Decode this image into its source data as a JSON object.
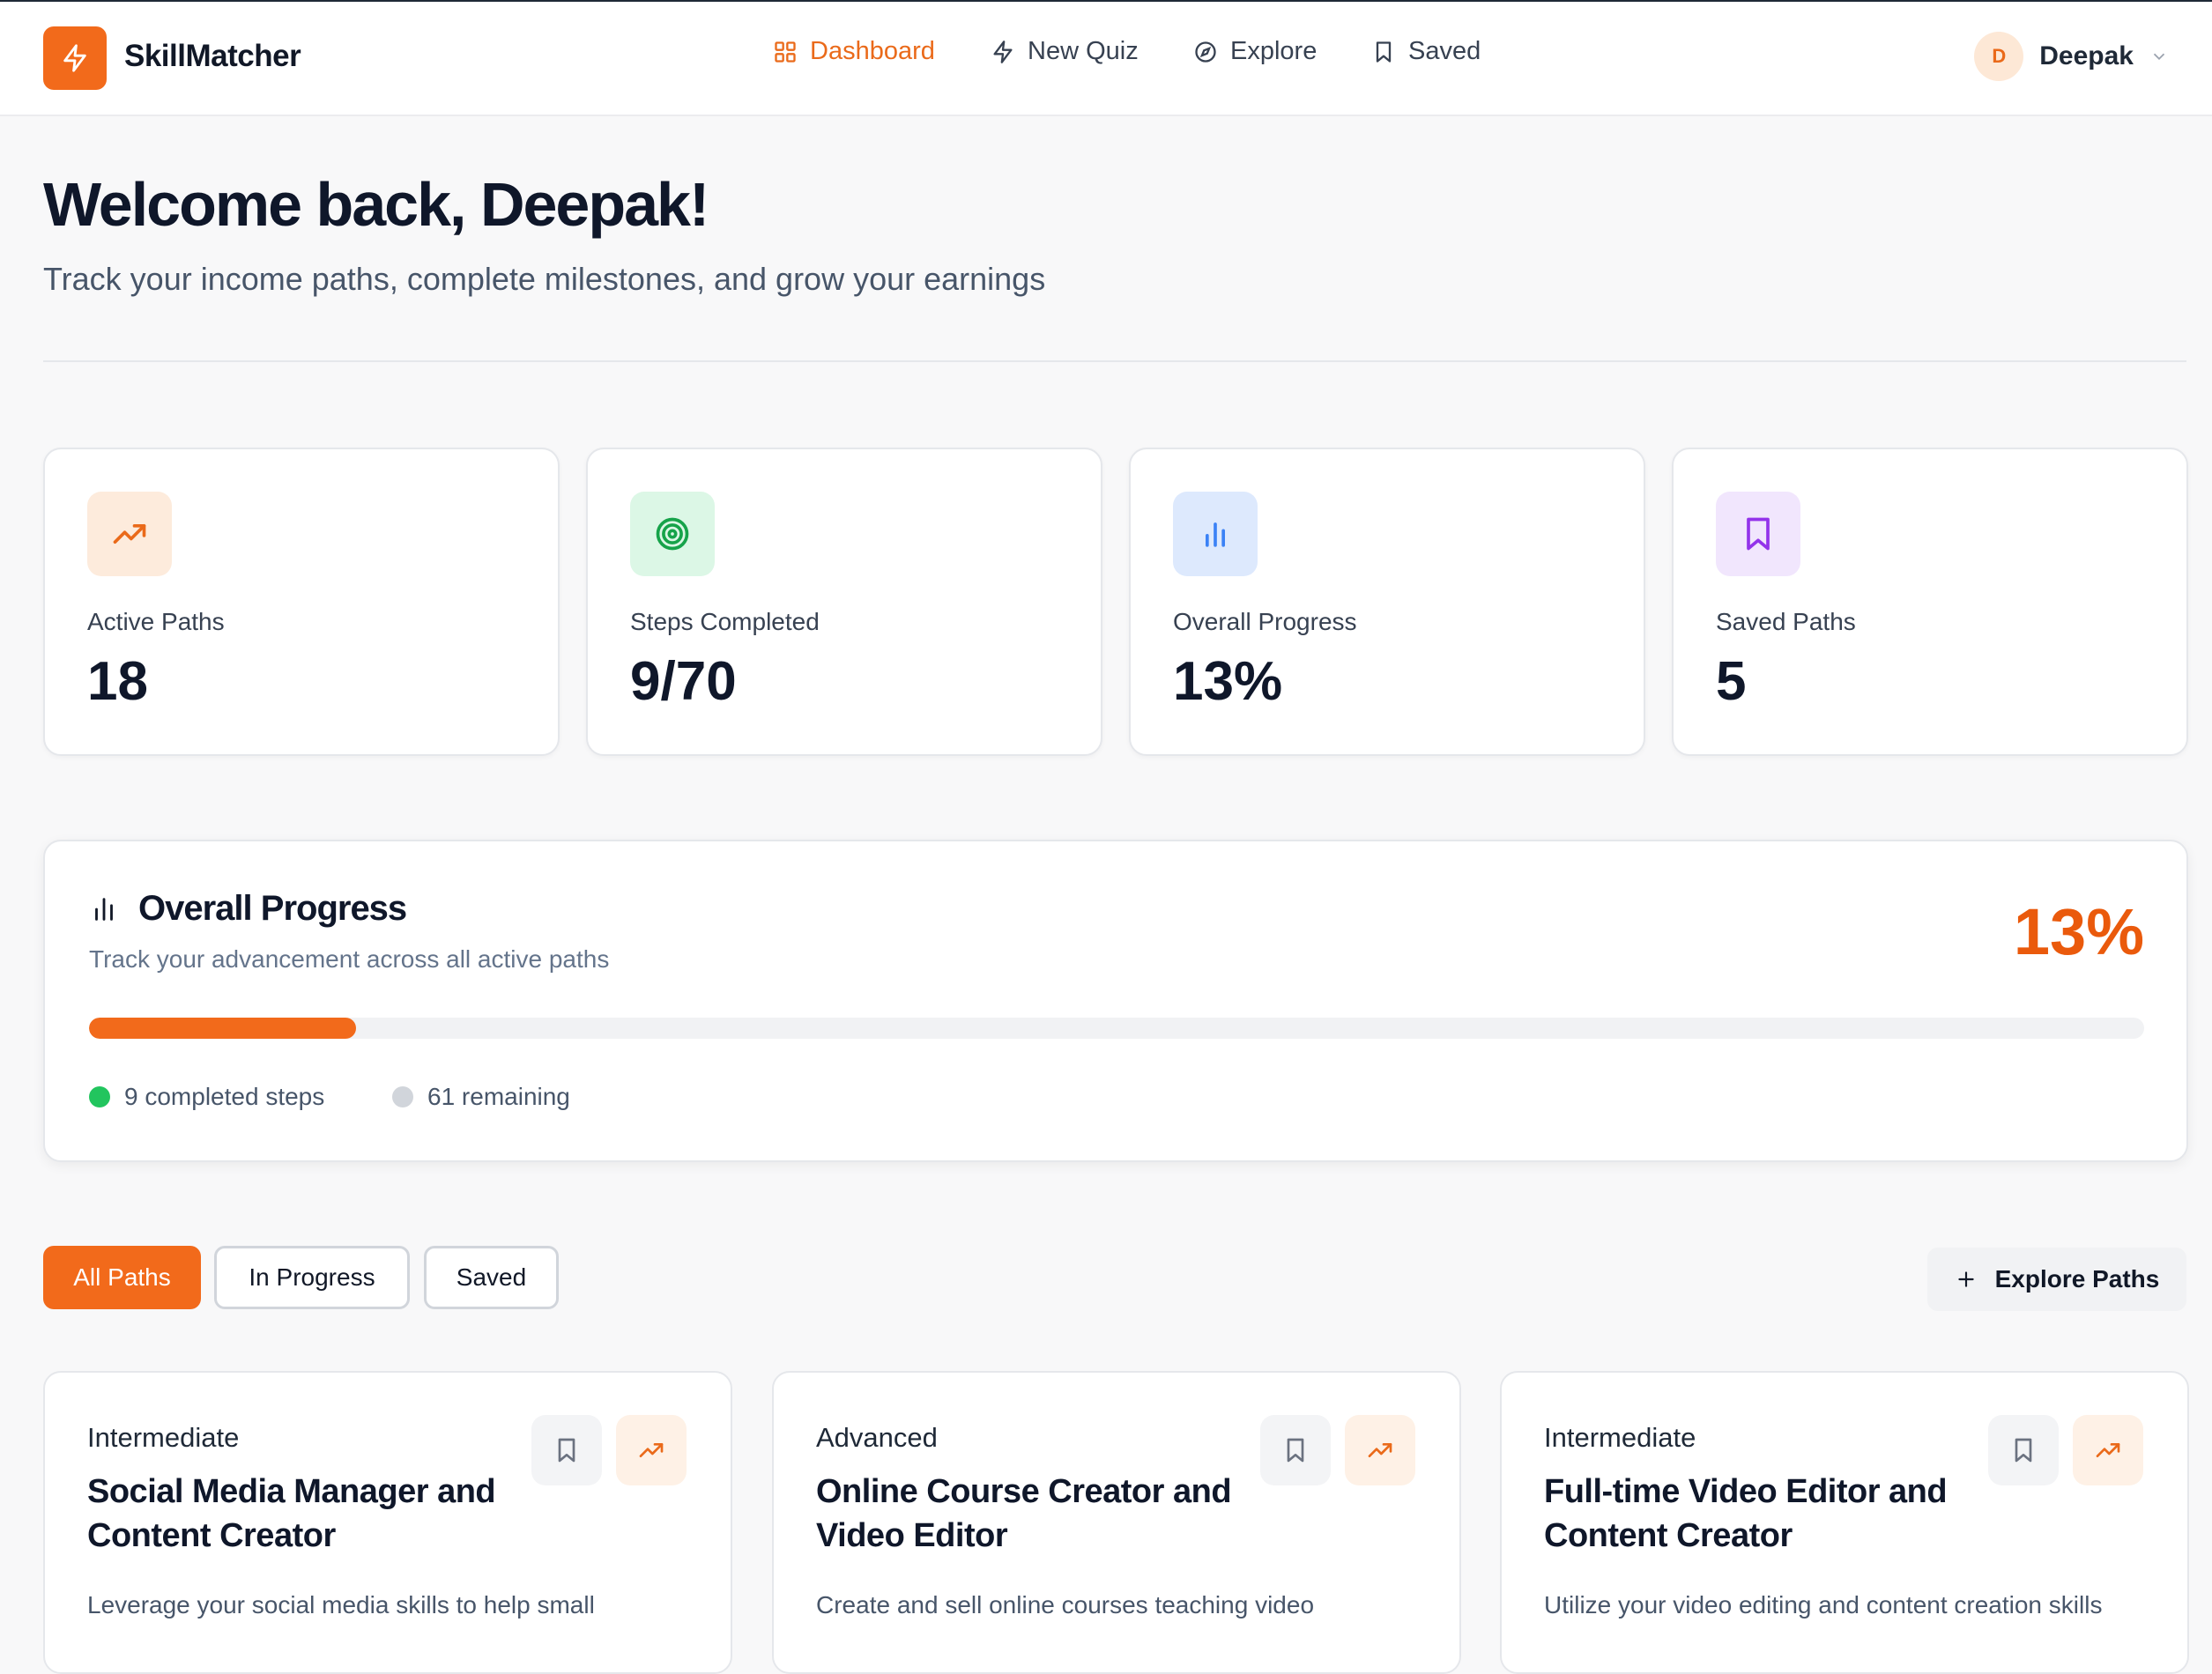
{
  "app": {
    "name": "SkillMatcher"
  },
  "nav": {
    "dashboard": "Dashboard",
    "new_quiz": "New Quiz",
    "explore": "Explore",
    "saved": "Saved"
  },
  "user": {
    "initial": "D",
    "name": "Deepak"
  },
  "welcome": {
    "title": "Welcome back, Deepak!",
    "subtitle": "Track your income paths, complete milestones, and grow your earnings"
  },
  "stats": [
    {
      "label": "Active Paths",
      "value": "18",
      "icon": "trending-up-icon"
    },
    {
      "label": "Steps Completed",
      "value": "9/70",
      "icon": "target-icon"
    },
    {
      "label": "Overall Progress",
      "value": "13%",
      "icon": "bar-chart-icon"
    },
    {
      "label": "Saved Paths",
      "value": "5",
      "icon": "bookmark-icon"
    }
  ],
  "progress": {
    "title": "Overall Progress",
    "subtitle": "Track your advancement across all active paths",
    "percent_label": "13%",
    "fraction": 0.13,
    "completed_label": "9 completed steps",
    "remaining_label": "61 remaining"
  },
  "filters": {
    "all": "All Paths",
    "in_progress": "In Progress",
    "saved": "Saved",
    "explore": "Explore Paths"
  },
  "paths": [
    {
      "level": "Intermediate",
      "title": "Social Media Manager and Content Creator",
      "description": "Leverage your social media skills to help small"
    },
    {
      "level": "Advanced",
      "title": "Online Course Creator and Video Editor",
      "description": "Create and sell online courses teaching video"
    },
    {
      "level": "Intermediate",
      "title": "Full-time Video Editor and Content Creator",
      "description": "Utilize your video editing and content creation skills"
    }
  ],
  "colors": {
    "accent": "#f26a1b",
    "accent_text": "#ea5a0c",
    "completed_dot": "#22c55e",
    "remaining_dot": "#d1d5db"
  }
}
